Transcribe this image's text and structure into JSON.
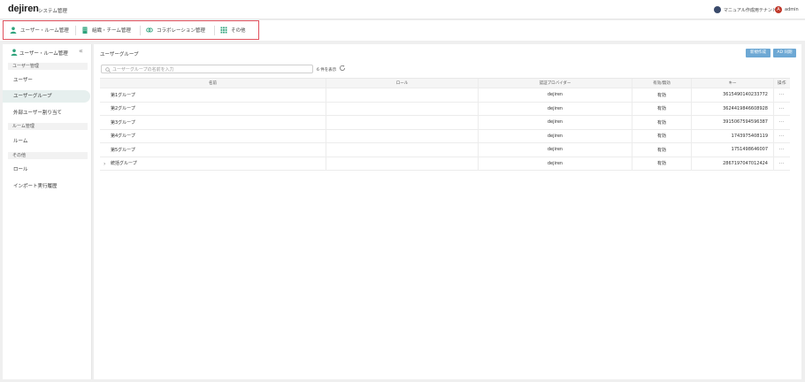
{
  "header": {
    "logo": "dejiren",
    "system_title": "システム管理",
    "tenant_name": "マニュアル作成用テナント",
    "avatar_initial": "A",
    "user": "admin"
  },
  "tabs": [
    {
      "label": "ユーザー・ルーム管理",
      "icon": "user-icon",
      "active": true
    },
    {
      "label": "組織・チーム管理",
      "icon": "building-icon",
      "active": false
    },
    {
      "label": "コラボレーション管理",
      "icon": "link-icon",
      "active": false
    },
    {
      "label": "その他",
      "icon": "grid-icon",
      "active": false
    }
  ],
  "sidebar": {
    "title": "ユーザー・ルーム管理",
    "collapse_glyph": "«",
    "sections": {
      "user_mgmt": "ユーザー管理",
      "room_mgmt": "ルーム管理",
      "other": "その他"
    },
    "items": {
      "user": "ユーザー",
      "user_group": "ユーザーグループ",
      "external_user": "外部ユーザー割り当て",
      "room": "ルーム",
      "role": "ロール",
      "import_history": "インポート実行履歴"
    },
    "active_item": "user_group"
  },
  "main": {
    "title": "ユーザーグループ",
    "btn_new": "新規作成",
    "btn_ad": "AD 同期",
    "search_placeholder": "ユーザーグループの名前を入力",
    "count_text": "6 件を表示"
  },
  "table": {
    "headers": [
      "名前",
      "ロール",
      "認証プロバイダー",
      "有効/無効",
      "キー",
      "操作"
    ],
    "rows": [
      {
        "name": "第1グループ",
        "role": "",
        "provider": "dejiren",
        "status": "有効",
        "key": "3615490140233772",
        "action": "···"
      },
      {
        "name": "第2グループ",
        "role": "",
        "provider": "dejiren",
        "status": "有効",
        "key": "3624419846608928",
        "action": "···"
      },
      {
        "name": "第3グループ",
        "role": "",
        "provider": "dejiren",
        "status": "有効",
        "key": "3915067594596387",
        "action": "···"
      },
      {
        "name": "第4グループ",
        "role": "",
        "provider": "dejiren",
        "status": "有効",
        "key": "1743975408119",
        "action": "···"
      },
      {
        "name": "第5グループ",
        "role": "",
        "provider": "dejiren",
        "status": "有効",
        "key": "1751498646007",
        "action": "···"
      },
      {
        "name": "統括グループ",
        "role": "",
        "provider": "dejiren",
        "status": "有効",
        "key": "2867197047012424",
        "action": "···"
      }
    ]
  },
  "colors": {
    "accent_green": "#2fa37c",
    "highlight_red": "#e0525e",
    "button_blue": "#6da8d4"
  }
}
